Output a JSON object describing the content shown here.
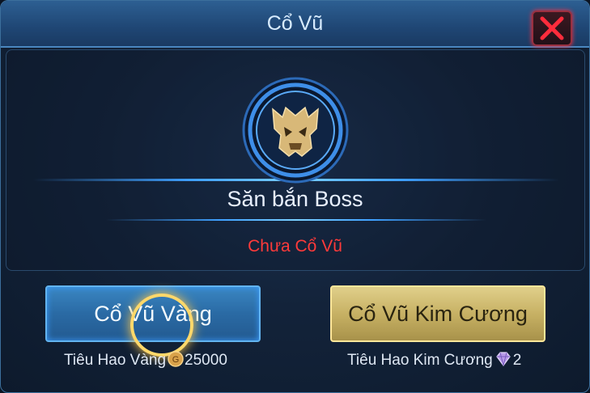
{
  "dialog": {
    "title": "Cổ Vũ",
    "close_icon": "close-x-icon"
  },
  "event": {
    "emblem_icon": "boss-skull-emblem-icon",
    "name": "Săn bắn Boss",
    "status": "Chưa Cổ Vũ",
    "status_color": "#ff3a3a"
  },
  "actions": {
    "gold": {
      "label": "Cổ Vũ Vàng",
      "cost_label": "Tiêu Hao Vàng",
      "cost_icon": "gold-coin-icon",
      "cost_value": "25000",
      "color": "#2a6aa4"
    },
    "diamond": {
      "label": "Cổ Vũ Kim Cương",
      "cost_label": "Tiêu Hao Kim Cương",
      "cost_icon": "diamond-gem-icon",
      "cost_value": "2",
      "color": "#c7b164"
    }
  }
}
